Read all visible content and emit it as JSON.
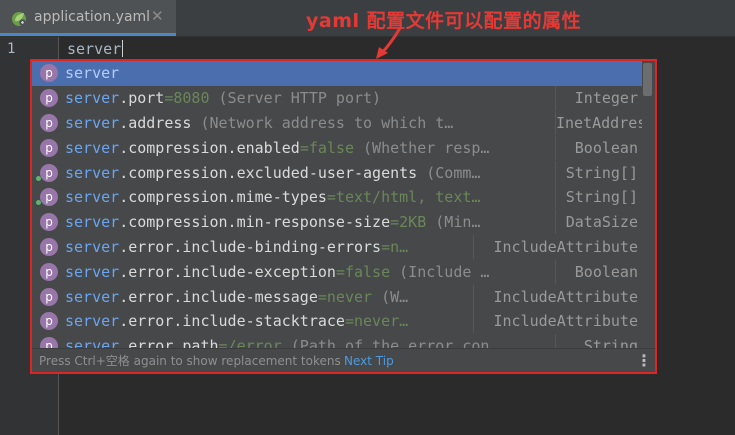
{
  "tab": {
    "filename": "application.yaml",
    "close_glyph": "✕",
    "icon": "spring-leaf-icon"
  },
  "annotation": {
    "text": "yaml 配置文件可以配置的属性",
    "color": "#e53935"
  },
  "editor": {
    "line_number": "1",
    "typed_text": "server"
  },
  "popup": {
    "icon_letter": "p",
    "typed_prefix": "server",
    "items": [
      {
        "rest": "",
        "default": "",
        "desc": "",
        "type": "",
        "selected": true,
        "dot": false
      },
      {
        "rest": ".port",
        "default": "=8080",
        "desc": " (Server HTTP port)",
        "type": "Integer",
        "selected": false,
        "dot": false
      },
      {
        "rest": ".address",
        "default": "",
        "desc": " (Network address to which t…",
        "type": "InetAddress",
        "selected": false,
        "dot": false
      },
      {
        "rest": ".compression.enabled",
        "default": "=false",
        "desc": " (Whether resp…",
        "type": "Boolean",
        "selected": false,
        "dot": false
      },
      {
        "rest": ".compression.excluded-user-agents",
        "default": "",
        "desc": " (Comm…",
        "type": "String[]",
        "selected": false,
        "dot": true
      },
      {
        "rest": ".compression.mime-types",
        "default": "=text/html, text…",
        "desc": "",
        "type": "String[]",
        "selected": false,
        "dot": true
      },
      {
        "rest": ".compression.min-response-size",
        "default": "=2KB",
        "desc": " (Min…",
        "type": "DataSize",
        "selected": false,
        "dot": false
      },
      {
        "rest": ".error.include-binding-errors",
        "default": "=n…",
        "desc": "",
        "type": "IncludeAttribute",
        "selected": false,
        "dot": false
      },
      {
        "rest": ".error.include-exception",
        "default": "=false",
        "desc": " (Include …",
        "type": "Boolean",
        "selected": false,
        "dot": false
      },
      {
        "rest": ".error.include-message",
        "default": "=never",
        "desc": " (W…",
        "type": "IncludeAttribute",
        "selected": false,
        "dot": false
      },
      {
        "rest": ".error.include-stacktrace",
        "default": "=never…",
        "desc": "",
        "type": "IncludeAttribute",
        "selected": false,
        "dot": false
      },
      {
        "rest": ".error.path",
        "default": "=/error",
        "desc": " (Path of the error con…",
        "type": "String",
        "selected": false,
        "dot": false
      }
    ],
    "footer_hint": "Press Ctrl+空格  again to show replacement tokens",
    "footer_link": "Next Tip",
    "footer_more": "⋮"
  },
  "colors": {
    "highlight_border": "#e02424",
    "selection": "#4b6eaf",
    "property_icon": "#9876aa",
    "prefix": "#6ba5f0",
    "default_value": "#6a8759"
  }
}
